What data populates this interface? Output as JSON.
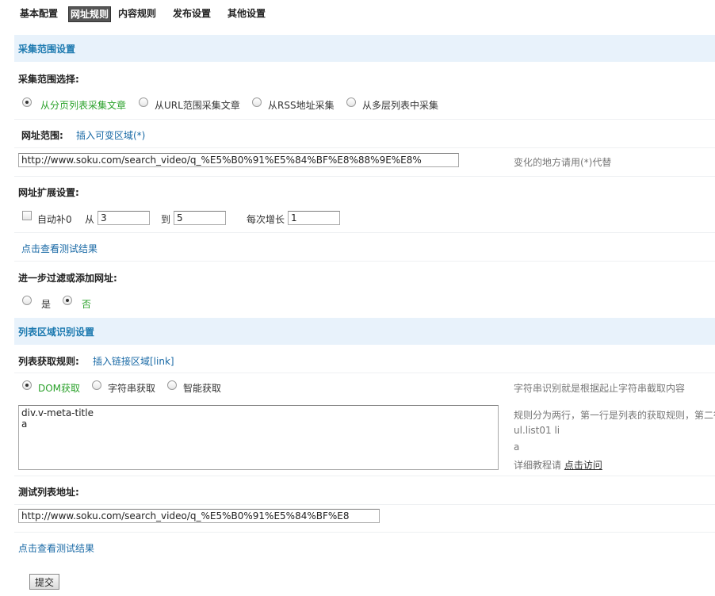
{
  "tabs": [
    "基本配置",
    "网址规则",
    "内容规则",
    "发布设置",
    "其他设置"
  ],
  "active_tab": "网址规则",
  "range_section": {
    "title": "采集范围设置",
    "choose_label": "采集范围选择:",
    "options": [
      "从分页列表采集文章",
      "从URL范围采集文章",
      "从RSS地址采集",
      "从多层列表中采集"
    ],
    "selected": "从分页列表采集文章"
  },
  "url_range": {
    "label": "网址范围:",
    "insert_link": "插入可变区域(*)",
    "value": "http://www.soku.com/search_video/q_%E5%B0%91%E5%84%BF%E8%88%9E%E8%",
    "hint": "变化的地方请用(*)代替"
  },
  "url_ext": {
    "label": "网址扩展设置:",
    "auto_pad_label": "自动补0",
    "auto_pad_checked": false,
    "from_label": "从",
    "from_value": "3",
    "to_label": "到",
    "to_value": "5",
    "step_label": "每次增长",
    "step_value": "1",
    "test_link": "点击查看测试结果"
  },
  "filter": {
    "label": "进一步过滤或添加网址:",
    "options": [
      "是",
      "否"
    ],
    "selected": "否"
  },
  "list_section": {
    "title": "列表区域识别设置",
    "rule_label": "列表获取规则:",
    "insert_link": "插入链接区域[link]",
    "options": [
      "DOM获取",
      "字符串获取",
      "智能获取"
    ],
    "selected": "DOM获取",
    "string_hint": "字符串识别就是根据起止字符串截取内容",
    "rule_text": "div.v-meta-title\na",
    "help_line1": "规则分为两行，第一行是列表的获取规则，第二行是",
    "help_line2": "ul.list01 li",
    "help_line3": "a",
    "help_prefix": "详细教程请",
    "help_link": "点击访问"
  },
  "test_list": {
    "label": "测试列表地址:",
    "value": "http://www.soku.com/search_video/q_%E5%B0%91%E5%84%BF%E8",
    "test_link": "点击查看测试结果"
  },
  "submit_label": "提交"
}
